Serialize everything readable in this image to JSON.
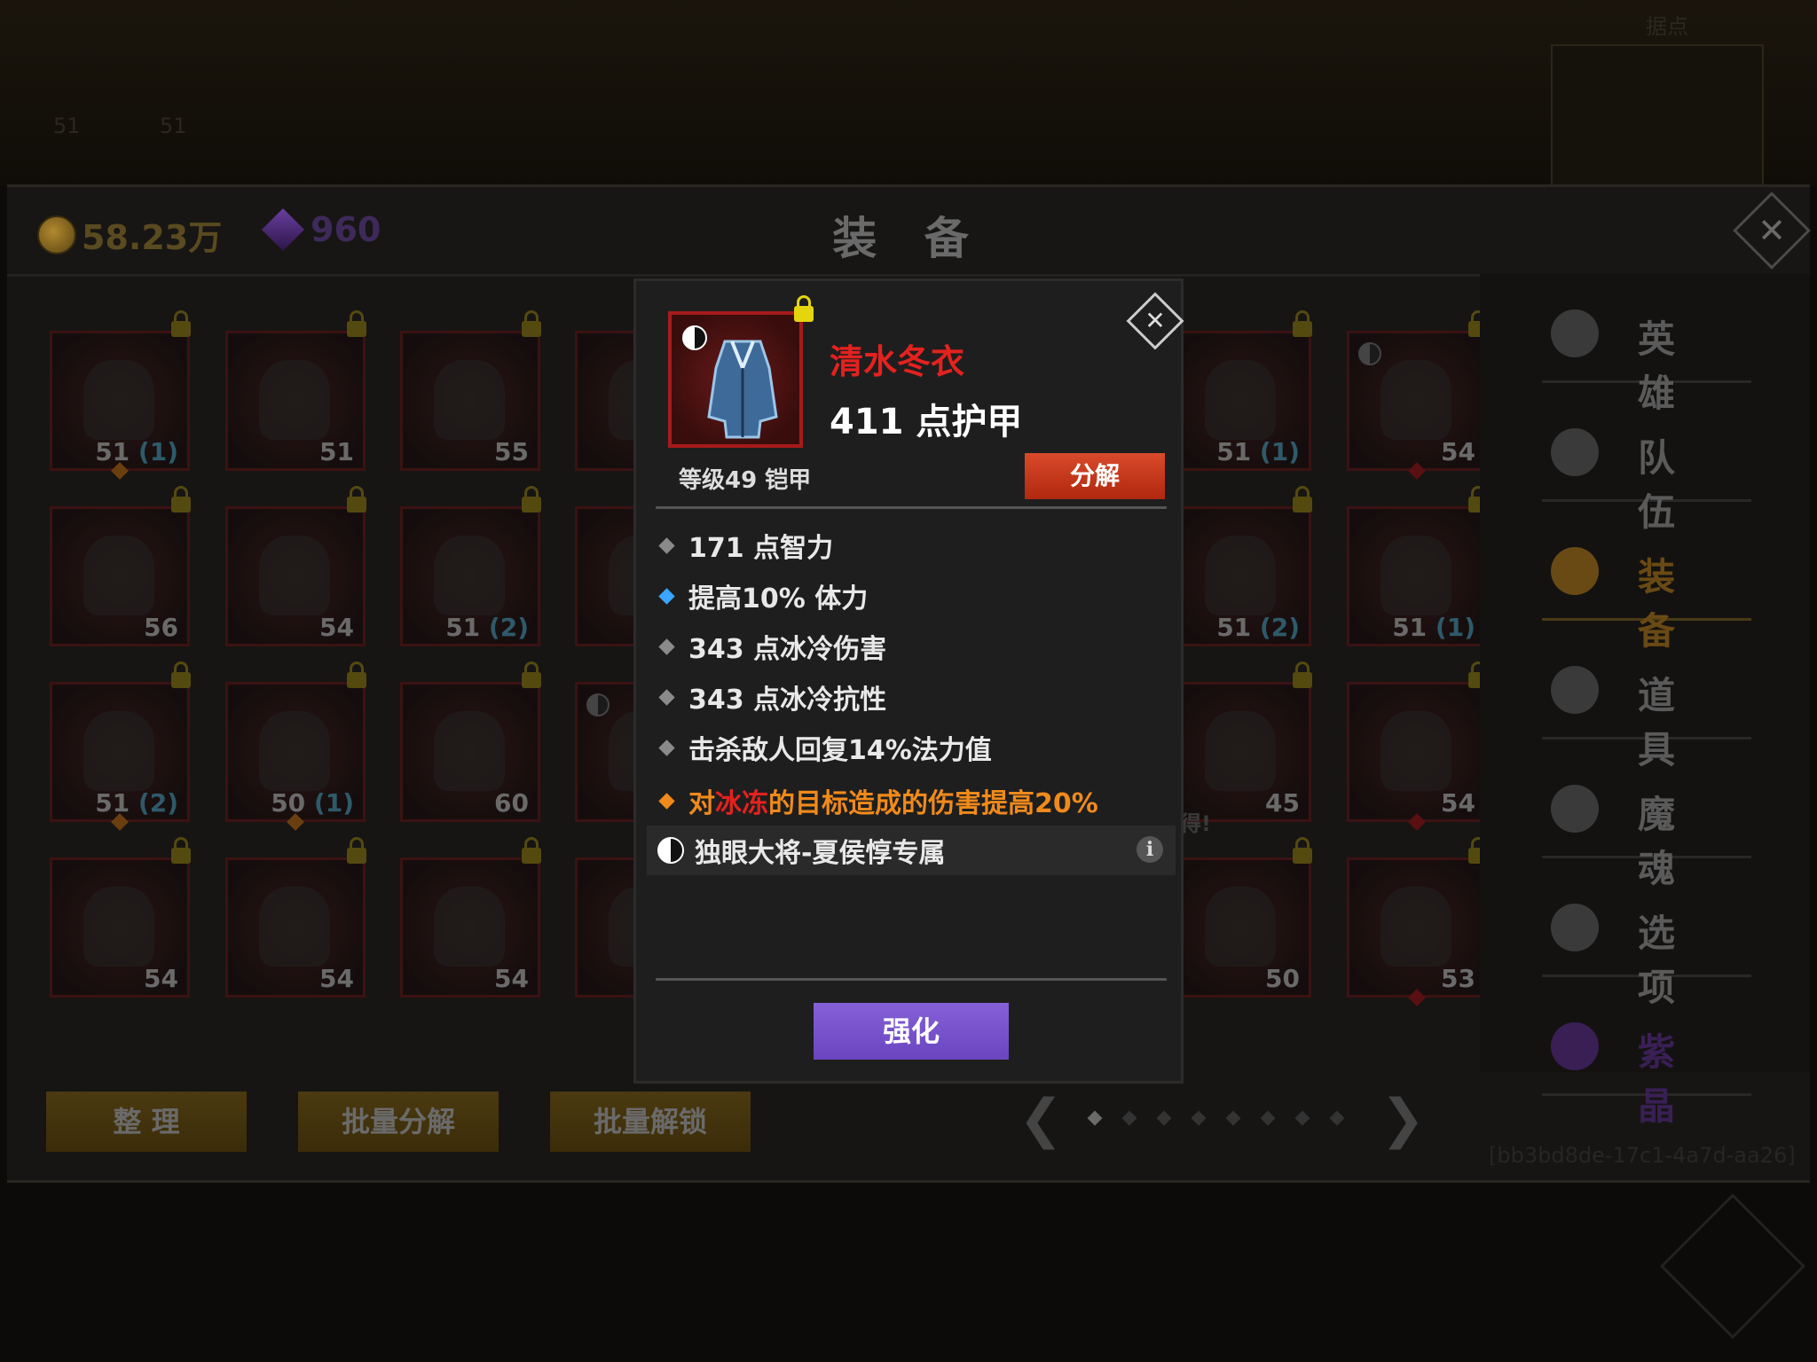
{
  "background": {
    "minimap_title": "据点",
    "top_numbers": [
      "51",
      "51"
    ]
  },
  "header": {
    "gold": "58.23万",
    "gems": "960",
    "title": "装 备"
  },
  "grid": {
    "slots": [
      {
        "lvl": "51",
        "sub": "(1)",
        "lock": true,
        "diamond": "orange"
      },
      {
        "lvl": "51",
        "sub": "",
        "lock": true
      },
      {
        "lvl": "55",
        "sub": "",
        "lock": true
      },
      {
        "lvl": "",
        "sub": "",
        "lock": true
      },
      {
        "lvl": "51",
        "sub": "(1)",
        "lock": true
      },
      {
        "lvl": "54",
        "sub": "",
        "lock": true,
        "yy": true,
        "diamond": "red"
      },
      {
        "lvl": "56",
        "sub": "",
        "lock": true
      },
      {
        "lvl": "54",
        "sub": "",
        "lock": true
      },
      {
        "lvl": "51",
        "sub": "(2)",
        "lock": true
      },
      {
        "lvl": "",
        "sub": "",
        "lock": true
      },
      {
        "lvl": "51",
        "sub": "(2)",
        "lock": true
      },
      {
        "lvl": "51",
        "sub": "(1)",
        "lock": true
      },
      {
        "lvl": "51",
        "sub": "(2)",
        "lock": true,
        "diamond": "orange"
      },
      {
        "lvl": "50",
        "sub": "(1)",
        "lock": true,
        "diamond": "orange"
      },
      {
        "lvl": "60",
        "sub": "",
        "lock": true
      },
      {
        "lvl": "",
        "sub": "",
        "lock": false,
        "yy": true
      },
      {
        "lvl": "45",
        "sub": "",
        "lock": true
      },
      {
        "lvl": "54",
        "sub": "",
        "lock": true,
        "diamond": "red"
      },
      {
        "lvl": "54",
        "sub": "",
        "lock": true
      },
      {
        "lvl": "54",
        "sub": "",
        "lock": true
      },
      {
        "lvl": "54",
        "sub": "",
        "lock": true
      },
      {
        "lvl": "",
        "sub": "",
        "lock": false
      },
      {
        "lvl": "50",
        "sub": "",
        "lock": true
      },
      {
        "lvl": "53",
        "sub": "",
        "lock": true,
        "diamond": "red"
      }
    ],
    "slot_hint": "得!"
  },
  "bottom_buttons": [
    "整 理",
    "批量分解",
    "批量解锁"
  ],
  "pager": {
    "total": 8,
    "current": 1,
    "prev": "❮",
    "next": "❯"
  },
  "sidebar": {
    "items": [
      {
        "label": "英 雄",
        "state": "normal"
      },
      {
        "label": "队 伍",
        "state": "normal"
      },
      {
        "label": "装 备",
        "state": "active"
      },
      {
        "label": "道 具",
        "state": "normal"
      },
      {
        "label": "魔 魂",
        "state": "normal"
      },
      {
        "label": "选 项",
        "state": "normal"
      },
      {
        "label": "紫 晶",
        "state": "purple"
      }
    ],
    "uid": "[bb3bd8de-17c1-4a7d-aa26]"
  },
  "modal": {
    "name": "清水冬衣",
    "main_stat": "411 点护甲",
    "level_type": "等级49 铠甲",
    "decompose": "分解",
    "stats": [
      {
        "text": "171 点智力",
        "color": "gray"
      },
      {
        "text": "提高10% 体力",
        "color": "blue"
      },
      {
        "text": "343 点冰冷伤害",
        "color": "gray"
      },
      {
        "text": "343 点冰冷抗性",
        "color": "gray"
      },
      {
        "text": "击杀敌人回复14%法力值",
        "color": "gray"
      }
    ],
    "special": {
      "prefix": "对",
      "highlight": "冰冻",
      "suffix": "的目标造成的伤害提高20%"
    },
    "set_text": "独眼大将-夏侯惇专属",
    "info": "i",
    "enhance": "强化",
    "close": "✕"
  },
  "colors": {
    "item_name": "#e3221f",
    "special_stat": "#f08a1b",
    "enhance_button": "#7a55cf",
    "decompose_button": "#c83a1c"
  }
}
